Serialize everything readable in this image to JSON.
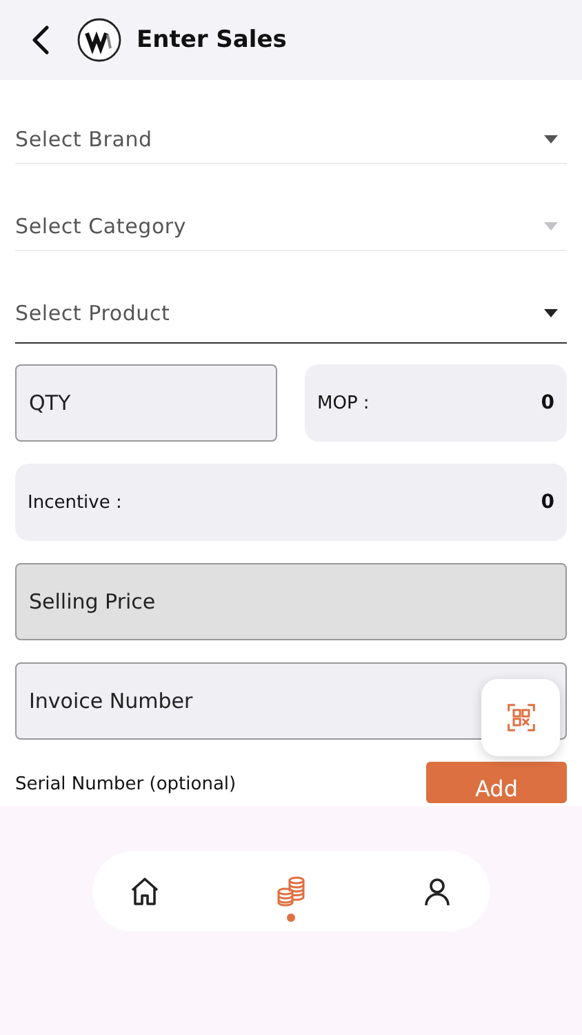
{
  "header": {
    "title": "Enter Sales"
  },
  "selects": [
    {
      "placeholder": "Select Brand",
      "disabled": false,
      "active": false
    },
    {
      "placeholder": "Select Category",
      "disabled": true,
      "active": false
    },
    {
      "placeholder": "Select Product",
      "disabled": false,
      "active": true
    }
  ],
  "qty": {
    "placeholder": "QTY"
  },
  "mop": {
    "label": "MOP :",
    "value": "0"
  },
  "incentive": {
    "label": "Incentive :",
    "value": "0"
  },
  "fields": [
    {
      "placeholder": "Selling Price",
      "disabled": true
    },
    {
      "placeholder": "Invoice Number",
      "disabled": false
    }
  ],
  "serial": {
    "label": "Serial Number (optional)",
    "button": "Add"
  },
  "nav": [
    {
      "kind": "home",
      "selected": false
    },
    {
      "kind": "sales",
      "selected": true
    },
    {
      "kind": "profile",
      "selected": false
    }
  ]
}
